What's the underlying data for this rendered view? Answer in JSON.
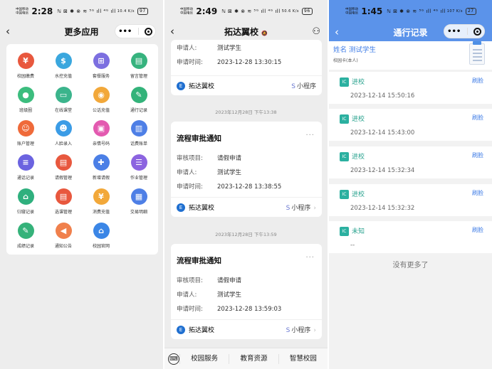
{
  "left": {
    "status": {
      "carrier1": "中国移动",
      "carrier2": "中国电信",
      "time": "2:28",
      "icons": "ℕ ⊠ ✱ ⊗ ≋ ⁵ᴳ ıll ⁴ᴳ ıll",
      "net": "10.4 K/s",
      "battery": "97"
    },
    "nav": {
      "back": "‹",
      "title": "更多应用"
    },
    "capsule": {
      "dots": "•••"
    },
    "apps": [
      {
        "label": "校园缴费",
        "icon": "¥",
        "color": "#e8583e",
        "icon_name": "yuan-icon"
      },
      {
        "label": "水控充值",
        "icon": "$",
        "color": "#3aa7de",
        "icon_name": "water-bag-icon"
      },
      {
        "label": "套餐服务",
        "icon": "⊞",
        "color": "#7c6fe0",
        "icon_name": "package-icon"
      },
      {
        "label": "留言管理",
        "icon": "▤",
        "color": "#36b37e",
        "icon_name": "message-icon"
      },
      {
        "label": "班级圈",
        "icon": "●",
        "color": "#3cbd7e",
        "icon_name": "class-group-icon"
      },
      {
        "label": "在线课堂",
        "icon": "▭",
        "color": "#3bb48c",
        "icon_name": "online-class-icon"
      },
      {
        "label": "公话充值",
        "icon": "◉",
        "color": "#f2a83a",
        "icon_name": "phone-recharge-icon"
      },
      {
        "label": "通行记录",
        "icon": "✎",
        "color": "#33b37a",
        "icon_name": "access-record-icon"
      },
      {
        "label": "账户管理",
        "icon": "☺",
        "color": "#ef6a3a",
        "icon_name": "account-icon"
      },
      {
        "label": "人脸录入",
        "icon": "☻",
        "color": "#3b9ce6",
        "icon_name": "face-icon"
      },
      {
        "label": "亲情号码",
        "icon": "▣",
        "color": "#e35ab0",
        "icon_name": "family-number-icon"
      },
      {
        "label": "话费账单",
        "icon": "▥",
        "color": "#4e7fe6",
        "icon_name": "bill-icon"
      },
      {
        "label": "通话记录",
        "icon": "≡",
        "color": "#6b63e0",
        "icon_name": "call-log-icon"
      },
      {
        "label": "请假管理",
        "icon": "▤",
        "color": "#e8583e",
        "icon_name": "leave-icon"
      },
      {
        "label": "新增请假",
        "icon": "✚",
        "color": "#4b7fe6",
        "icon_name": "new-leave-icon"
      },
      {
        "label": "作业管理",
        "icon": "☰",
        "color": "#8c64e0",
        "icon_name": "homework-icon"
      },
      {
        "label": "归寝记录",
        "icon": "⌂",
        "color": "#2fb07e",
        "icon_name": "dorm-icon"
      },
      {
        "label": "选课管理",
        "icon": "▤",
        "color": "#e8583e",
        "icon_name": "course-icon"
      },
      {
        "label": "消费充值",
        "icon": "¥",
        "color": "#f2a83a",
        "icon_name": "consume-icon"
      },
      {
        "label": "交易明细",
        "icon": "▦",
        "color": "#4e7fe6",
        "icon_name": "transaction-icon"
      },
      {
        "label": "成绩记录",
        "icon": "✎",
        "color": "#35b27a",
        "icon_name": "grade-icon"
      },
      {
        "label": "通知公告",
        "icon": "◀",
        "color": "#f0804c",
        "icon_name": "notice-icon"
      },
      {
        "label": "校园官网",
        "icon": "⌂",
        "color": "#3b86e6",
        "icon_name": "website-icon"
      }
    ]
  },
  "middle": {
    "status": {
      "carrier1": "中国移动",
      "carrier2": "中国电信",
      "time": "2:49",
      "icons": "ℕ ⊠ ✱ ⊗ ≋ ⁵ᴳ ıll ⁴ᴳ ıll",
      "net": "50.6 K/s",
      "battery": "96"
    },
    "nav": {
      "back": "‹",
      "title": "拓达翼校",
      "mute": "🔕",
      "person": "⚇"
    },
    "card0": {
      "applicant_k": "申请人:",
      "applicant_v": "测试学生",
      "time_k": "申请时间:",
      "time_v": "2023-12-28 13:30:15"
    },
    "footer": {
      "brand": "拓达翼校",
      "mini": "小程序",
      "brand_glyph": "E",
      "mini_glyph": "S"
    },
    "date1": "2023年12月28日 下午13:38",
    "card1": {
      "title": "流程审批通知",
      "project_k": "审核项目:",
      "project_v": "请假申请",
      "applicant_k": "申请人:",
      "applicant_v": "测试学生",
      "time_k": "申请时间:",
      "time_v": "2023-12-28 13:38:55"
    },
    "date2": "2023年12月28日 下午13:59",
    "card2": {
      "title": "流程审批通知",
      "project_k": "审核项目:",
      "project_v": "请假申请",
      "applicant_k": "申请人:",
      "applicant_v": "测试学生",
      "time_k": "申请时间:",
      "time_v": "2023-12-28 13:59:03"
    },
    "bottom": {
      "kb": "⌨",
      "items": [
        "校园服务",
        "教育资源",
        "智慧校园"
      ]
    }
  },
  "right": {
    "status": {
      "carrier1": "中国移动",
      "carrier2": "中国电信",
      "time": "1:45",
      "icons": "ℕ ⊠ ✱ ⊗ ≋ ⁵ᴳ ıll ⁴ᴳ ıll",
      "net": "107 K/s",
      "battery": "27"
    },
    "nav": {
      "back": "‹",
      "title": "通行记录"
    },
    "user": {
      "name": "姓名 测试学生",
      "sub": "校园卡(本人)"
    },
    "records": [
      {
        "kind": "进校",
        "src": "刷脸",
        "time": "2023-12-14 15:50:16"
      },
      {
        "kind": "进校",
        "src": "刷脸",
        "time": "2023-12-14 15:43:00"
      },
      {
        "kind": "进校",
        "src": "刷脸",
        "time": "2023-12-14 15:32:34"
      },
      {
        "kind": "进校",
        "src": "刷脸",
        "time": "2023-12-14 15:32:32"
      },
      {
        "kind": "未知",
        "src": "刷脸",
        "time": "--"
      }
    ],
    "record_icon": "IC",
    "nomore": "没有更多了"
  }
}
